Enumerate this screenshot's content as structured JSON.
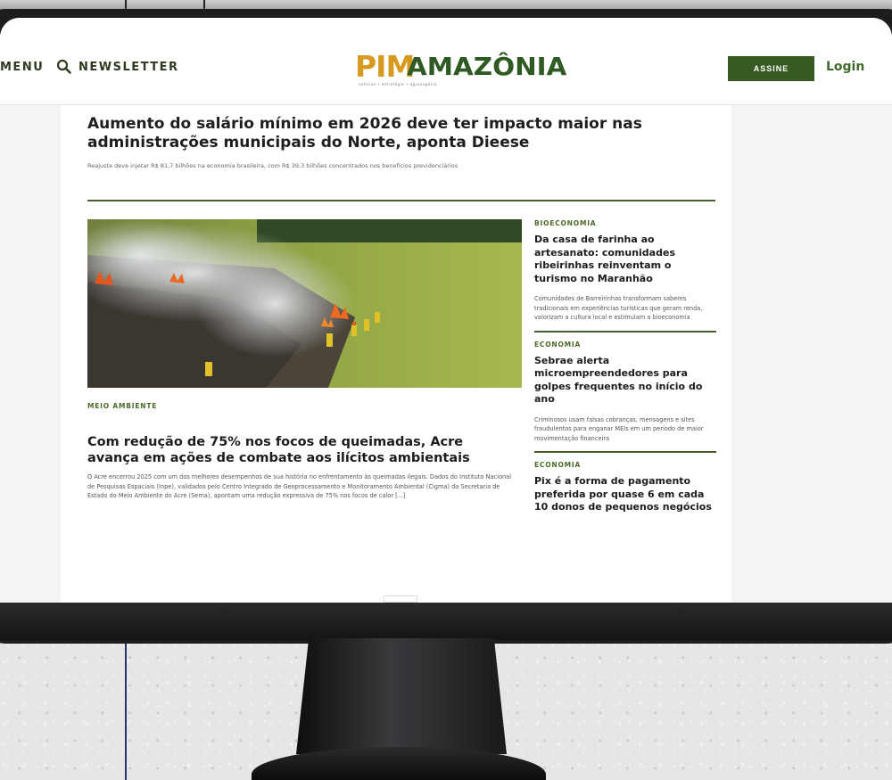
{
  "header": {
    "menu_label": "MENU",
    "search_icon": "search-icon",
    "newsletter_label": "NEWSLETTER",
    "logo_mark": "PIM",
    "logo_name": "AMAZÔNIA",
    "logo_tagline": "notícias • estratégia • agronegócio",
    "subscribe_label": "ASSINE",
    "login_label": "Login"
  },
  "lead": {
    "headline": "Aumento do salário mínimo em 2026 deve ter impacto maior nas administrações municipais do Norte, aponta Dieese",
    "subheadline": "Reajuste deve injetar R$ 81,7 bilhões na economia brasileira, com R$ 39,3 bilhões concentrados nos benefícios previdenciários"
  },
  "feature": {
    "tag": "MEIO AMBIENTE",
    "title": "Com redução de 75% nos focos de queimadas, Acre avança em ações de combate aos ilícitos ambientais",
    "body": "O Acre encerrou 2025 com um dos melhores desempenhos de sua história no enfrentamento às queimadas ilegais. Dados do Instituto Nacional de Pesquisas Espaciais (Inpe), validados pelo Centro Integrado de Geoprocessamento e Monitoramento Ambiental (Cigma) da Secretaria de Estado do Meio Ambiente do Acre (Sema), apontam uma redução expressiva de 75% nos focos de calor [...]"
  },
  "sidebar": {
    "items": [
      {
        "tag": "BIOECONOMIA",
        "title": "Da casa de farinha ao artesanato: comunidades ribeirinhas reinventam o turismo no Maranhão",
        "desc": "Comunidades de Barreirinhas transformam saberes tradicionais em experiências turísticas que geram renda, valorizam a cultura local e estimulam a bioeconomia"
      },
      {
        "tag": "ECONOMIA",
        "title": "Sebrae alerta microempreendedores para golpes frequentes no início do ano",
        "desc": "Criminosos usam falsas cobranças, mensagens e sites fraudulentos para enganar MEIs em um período de maior movimentação financeira"
      },
      {
        "tag": "ECONOMIA",
        "title": "Pix é a forma de pagamento preferida por quase 6 em cada 10 donos de pequenos negócios",
        "desc": ""
      }
    ]
  },
  "colors": {
    "brand_green": "#355b22",
    "brand_gold": "#d59a1f",
    "divider": "#4b5d2a"
  }
}
